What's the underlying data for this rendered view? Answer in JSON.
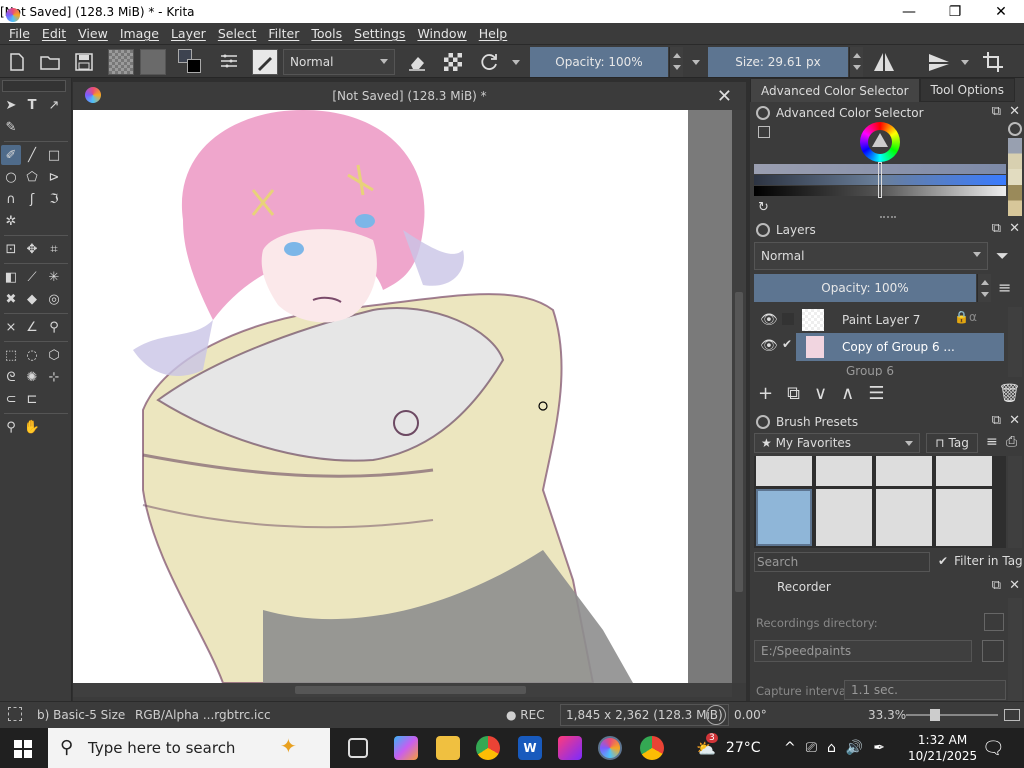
{
  "titlebar": {
    "title": "[Not Saved]  (128.3 MiB) * - Krita",
    "min": "—",
    "max": "❐",
    "close": "✕"
  },
  "menu": [
    "File",
    "Edit",
    "View",
    "Image",
    "Layer",
    "Select",
    "Filter",
    "Tools",
    "Settings",
    "Window",
    "Help"
  ],
  "toolbar": {
    "blend_mode": "Normal",
    "opacity_label": "Opacity: 100%",
    "size_label": "Size: 29.61 px"
  },
  "canvas": {
    "title": "[Not Saved]  (128.3 MiB) *",
    "close": "✕"
  },
  "dock": {
    "tab_color": "Advanced Color Selector",
    "tab_tool": "Tool Options",
    "color_panel": "Advanced Color Selector",
    "layers_panel": "Layers",
    "layers_blend": "Normal",
    "layers_opacity": "Opacity:  100%",
    "layers": [
      {
        "name": "Paint Layer 7"
      },
      {
        "name": "Copy of Group 6 ..."
      },
      {
        "name": "Group 6"
      }
    ],
    "brush_panel": "Brush Presets",
    "brush_tag": "My Favorites",
    "brush_tag_btn": "Tag",
    "brush_search_placeholder": "Search",
    "filter_in_tag": "Filter in Tag",
    "recorder_panel": "Recorder",
    "recordings_directory_label": "Recordings directory:",
    "recordings_directory_value": "E:/Speedpaints",
    "capture_interval_label": "Capture interval:",
    "capture_interval_value": "1.1 sec."
  },
  "status": {
    "brush": "b) Basic-5 Size",
    "color_space": "RGB/Alpha ...rgbtrc.icc",
    "rec": "● REC",
    "dims": "1,845 x 2,362 (128.3 MiB)",
    "rotation": "0.00°",
    "zoom": "33.3%"
  },
  "taskbar": {
    "search_placeholder": "Type here to search",
    "weather": "27°C",
    "time": "1:32 AM",
    "date": "10/21/2025",
    "badge": "3"
  },
  "colors": {
    "accent": "#5d7591",
    "bg": "#3b3b3b"
  }
}
